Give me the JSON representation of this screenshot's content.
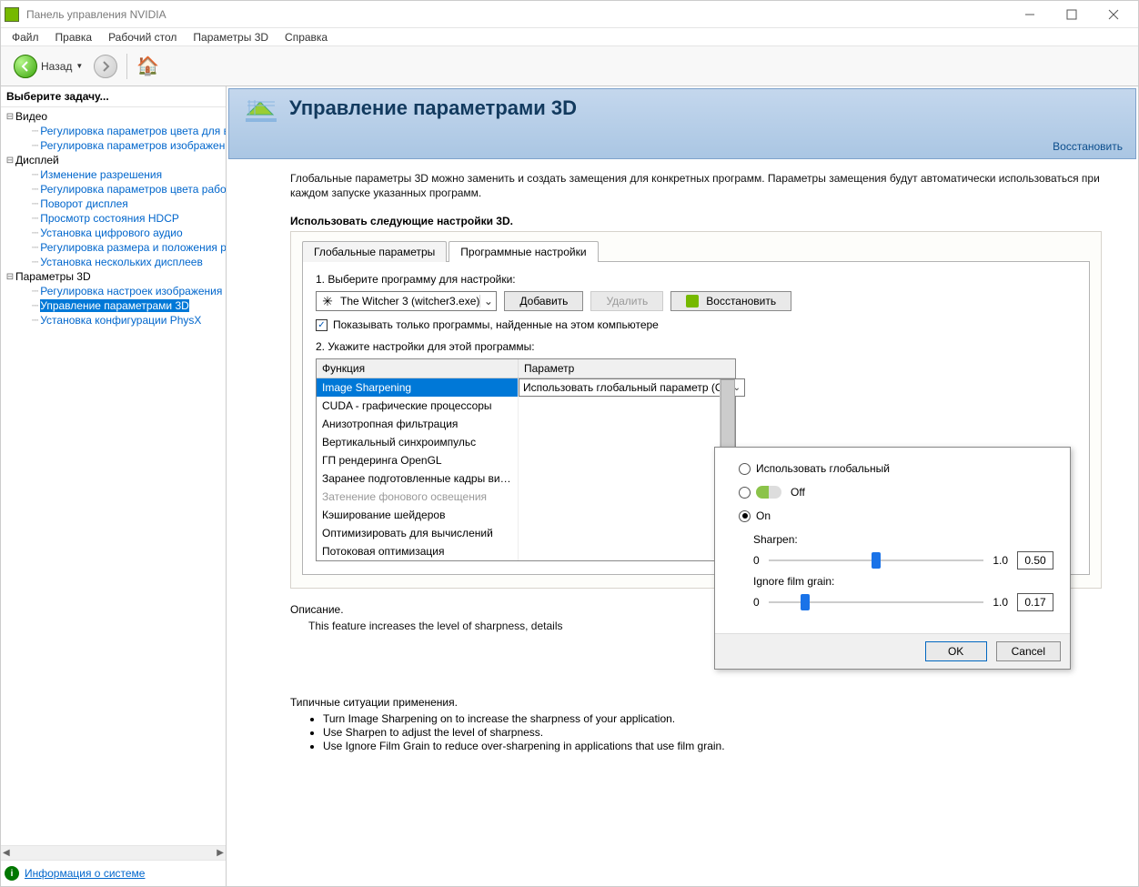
{
  "titlebar": {
    "text": "Панель управления NVIDIA"
  },
  "menubar": {
    "items": [
      "Файл",
      "Правка",
      "Рабочий стол",
      "Параметры 3D",
      "Справка"
    ]
  },
  "toolbar": {
    "back_label": "Назад"
  },
  "sidebar": {
    "header": "Выберите задачу...",
    "categories": {
      "video": {
        "label": "Видео",
        "items": [
          "Регулировка параметров цвета для вид",
          "Регулировка параметров изображения д"
        ]
      },
      "display": {
        "label": "Дисплей",
        "items": [
          "Изменение разрешения",
          "Регулировка параметров цвета рабочег",
          "Поворот дисплея",
          "Просмотр состояния HDCP",
          "Установка цифрового аудио",
          "Регулировка размера и положения рабо",
          "Установка нескольких дисплеев"
        ]
      },
      "params3d": {
        "label": "Параметры 3D",
        "items": [
          "Регулировка настроек изображения с пр",
          "Управление параметрами 3D",
          "Установка конфигурации PhysX"
        ],
        "selected_index": 1
      }
    },
    "footer_link": "Информация о системе"
  },
  "main": {
    "title": "Управление параметрами 3D",
    "restore_link": "Восстановить",
    "intro": "Глобальные параметры 3D можно заменить и создать замещения для конкретных программ. Параметры замещения будут автоматически использоваться при каждом запуске указанных программ.",
    "section_title": "Использовать следующие настройки 3D.",
    "tabs": {
      "global": "Глобальные параметры",
      "program": "Программные настройки"
    },
    "step1_label": "1. Выберите программу для настройки:",
    "program_combo": "The Witcher 3 (witcher3.exe)",
    "add_button": "Добавить",
    "remove_button": "Удалить",
    "restore_button": "Восстановить",
    "show_only_checkbox": "Показывать только программы, найденные на этом компьютере",
    "step2_label": "2. Укажите настройки для этой программы:",
    "col_function": "Функция",
    "col_param": "Параметр",
    "settings_rows": [
      "Image Sharpening",
      "CUDA - графические процессоры",
      "Анизотропная фильтрация",
      "Вертикальный синхроимпульс",
      "ГП рендеринга OpenGL",
      "Заранее подготовленные кадры вирту...",
      "Затенение фонового освещения",
      "Кэширование шейдеров",
      "Оптимизировать для вычислений",
      "Потоковая оптимизация"
    ],
    "selected_row_value": "Использовать глобальный параметр (Off)",
    "desc_title": "Описание.",
    "desc_text": "This feature increases the level of sharpness, details",
    "typical_title": "Типичные ситуации применения.",
    "typical_bullets": [
      "Turn Image Sharpening on to increase the sharpness of your application.",
      "Use Sharpen to adjust the level of sharpness.",
      "Use Ignore Film Grain to reduce over-sharpening in applications that use film grain."
    ]
  },
  "popup": {
    "radio_global": "Использовать глобальный",
    "radio_off": "Off",
    "radio_on": "On",
    "sharpen_label": "Sharpen:",
    "sharpen_min": "0",
    "sharpen_max": "1.0",
    "sharpen_value": "0.50",
    "grain_label": "Ignore film grain:",
    "grain_min": "0",
    "grain_max": "1.0",
    "grain_value": "0.17",
    "ok": "OK",
    "cancel": "Cancel"
  }
}
